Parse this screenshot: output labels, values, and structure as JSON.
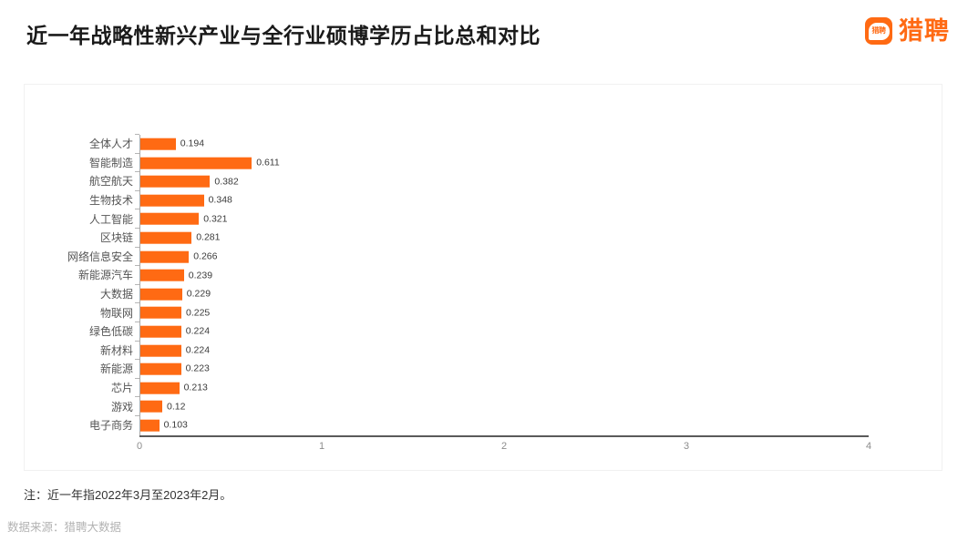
{
  "header": {
    "title": "近一年战略性新兴产业与全行业硕博学历占比总和对比",
    "brand": {
      "icon_text": "猎聘",
      "name": "猎聘",
      "color": "#FF6A13"
    }
  },
  "footnotes": {
    "note": "注：近一年指2022年3月至2023年2月。",
    "source": "数据来源：猎聘大数据"
  },
  "chart_data": {
    "type": "bar",
    "orientation": "horizontal",
    "title": "近一年战略性新兴产业与全行业硕博学历占比总和对比",
    "xlabel": "",
    "ylabel": "",
    "xlim": [
      0,
      4
    ],
    "xticks": [
      "0",
      "1",
      "2",
      "3",
      "4"
    ],
    "grid": false,
    "legend": false,
    "bar_color": "#FF6A13",
    "categories": [
      "全体人才",
      "智能制造",
      "航空航天",
      "生物技术",
      "人工智能",
      "区块链",
      "网络信息安全",
      "新能源汽车",
      "大数据",
      "物联网",
      "绿色低碳",
      "新材料",
      "新能源",
      "芯片",
      "游戏",
      "电子商务"
    ],
    "values": [
      0.194,
      0.611,
      0.382,
      0.348,
      0.321,
      0.281,
      0.266,
      0.239,
      0.229,
      0.225,
      0.224,
      0.224,
      0.223,
      0.213,
      0.12,
      0.103
    ],
    "value_labels": [
      "0.194",
      "0.611",
      "0.382",
      "0.348",
      "0.321",
      "0.281",
      "0.266",
      "0.239",
      "0.229",
      "0.225",
      "0.224",
      "0.224",
      "0.223",
      "0.213",
      "0.12",
      "0.103"
    ]
  }
}
